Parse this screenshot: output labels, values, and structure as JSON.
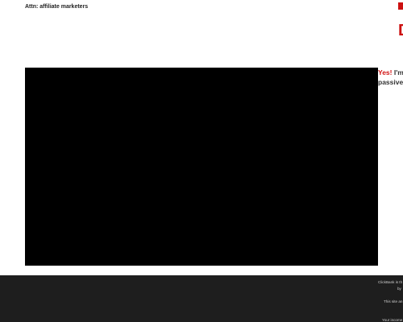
{
  "header": {
    "attn_text": "Attn: affiliate marketers"
  },
  "headline": {
    "large_fragment": "D"
  },
  "video": {
    "label": "video player"
  },
  "side": {
    "yes": "Yes!",
    "line1_rest": " I'm n",
    "line2": "passive i"
  },
  "footer": {
    "line1": "ClickBank is th",
    "line2": "by",
    "line3": "This site an",
    "line4": "Your income"
  },
  "colors": {
    "accent_red": "#cc1111",
    "footer_bg": "#1e1e1e",
    "video_bg": "#000000"
  }
}
